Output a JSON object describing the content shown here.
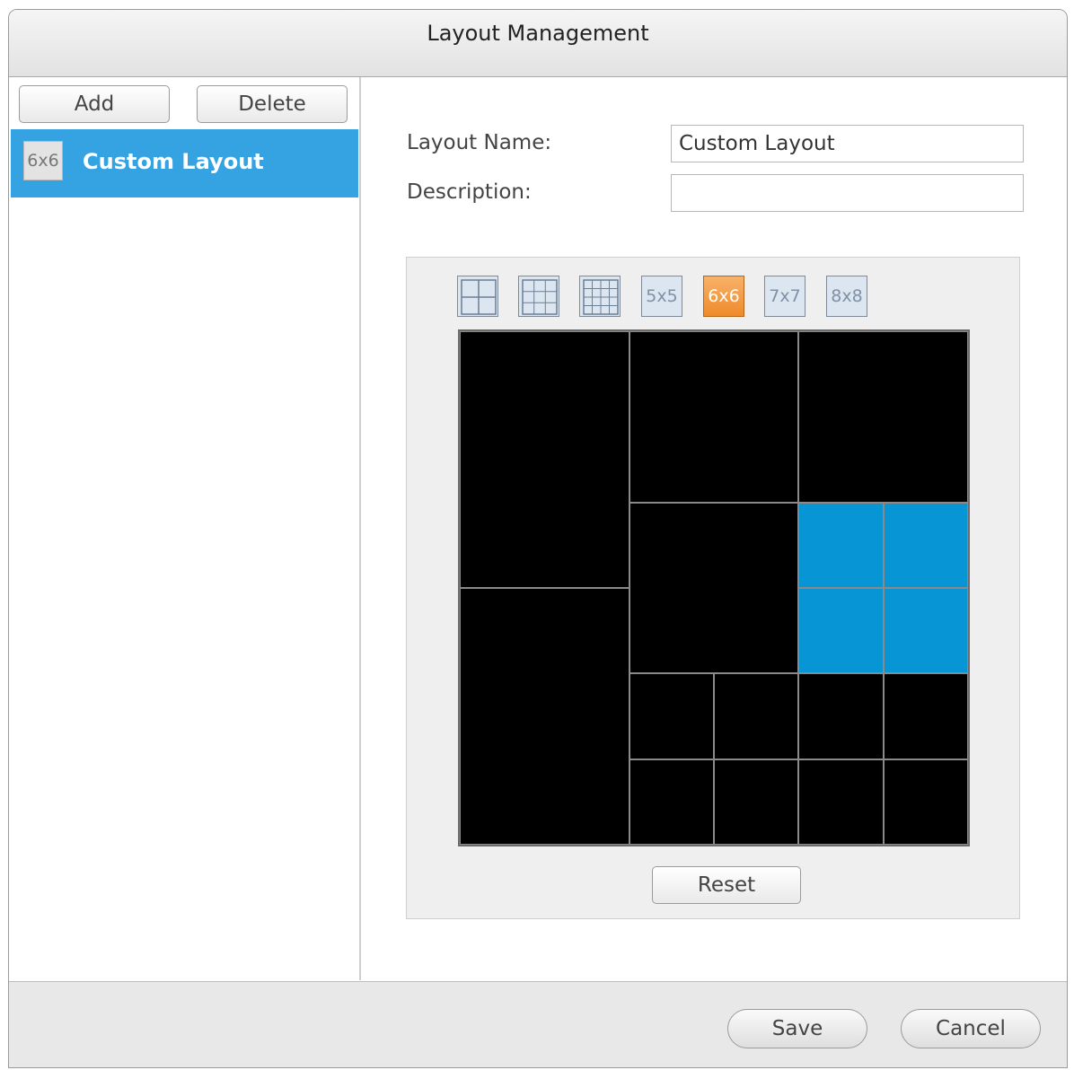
{
  "dialog": {
    "title": "Layout Management"
  },
  "sidebar": {
    "add_label": "Add",
    "delete_label": "Delete",
    "items": [
      {
        "thumb": "6x6",
        "label": "Custom Layout",
        "selected": true
      }
    ]
  },
  "form": {
    "name_label": "Layout Name:",
    "name_value": "Custom Layout",
    "description_label": "Description:",
    "description_value": ""
  },
  "grid_options": [
    {
      "kind": "2x2",
      "label": "",
      "icon": "grid-2x2-icon"
    },
    {
      "kind": "3x3",
      "label": "",
      "icon": "grid-3x3-icon"
    },
    {
      "kind": "4x4",
      "label": "",
      "icon": "grid-4x4-icon"
    },
    {
      "kind": "5x5",
      "label": "5x5"
    },
    {
      "kind": "6x6",
      "label": "6x6",
      "selected": true
    },
    {
      "kind": "7x7",
      "label": "7x7"
    },
    {
      "kind": "8x8",
      "label": "8x8"
    }
  ],
  "layout_grid": {
    "units": 6,
    "cells": [
      {
        "row": 0,
        "col": 0,
        "rowspan": 3,
        "colspan": 2
      },
      {
        "row": 0,
        "col": 2,
        "rowspan": 2,
        "colspan": 2
      },
      {
        "row": 0,
        "col": 4,
        "rowspan": 2,
        "colspan": 2
      },
      {
        "row": 3,
        "col": 0,
        "rowspan": 3,
        "colspan": 2
      },
      {
        "row": 2,
        "col": 2,
        "rowspan": 2,
        "colspan": 2
      },
      {
        "row": 2,
        "col": 4,
        "rowspan": 1,
        "colspan": 1,
        "selected": true
      },
      {
        "row": 2,
        "col": 5,
        "rowspan": 1,
        "colspan": 1,
        "selected": true
      },
      {
        "row": 3,
        "col": 4,
        "rowspan": 1,
        "colspan": 1,
        "selected": true
      },
      {
        "row": 3,
        "col": 5,
        "rowspan": 1,
        "colspan": 1,
        "selected": true
      },
      {
        "row": 4,
        "col": 2,
        "rowspan": 1,
        "colspan": 1
      },
      {
        "row": 4,
        "col": 3,
        "rowspan": 1,
        "colspan": 1
      },
      {
        "row": 4,
        "col": 4,
        "rowspan": 1,
        "colspan": 1
      },
      {
        "row": 4,
        "col": 5,
        "rowspan": 1,
        "colspan": 1
      },
      {
        "row": 5,
        "col": 2,
        "rowspan": 1,
        "colspan": 1
      },
      {
        "row": 5,
        "col": 3,
        "rowspan": 1,
        "colspan": 1
      },
      {
        "row": 5,
        "col": 4,
        "rowspan": 1,
        "colspan": 1
      },
      {
        "row": 5,
        "col": 5,
        "rowspan": 1,
        "colspan": 1
      }
    ],
    "selected_color": "#0895d6",
    "empty_color": "#000000"
  },
  "reset_label": "Reset",
  "footer": {
    "save_label": "Save",
    "cancel_label": "Cancel"
  },
  "colors": {
    "accent": "#35a3e2",
    "selected_grid_button": "#ef8a2a"
  }
}
